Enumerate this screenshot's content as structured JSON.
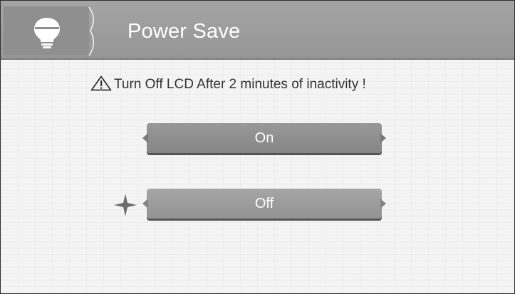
{
  "header": {
    "title": "Power Save",
    "icon": "lightbulb-icon"
  },
  "message": {
    "icon": "warning-icon",
    "text": "Turn Off LCD After 2 minutes of inactivity !"
  },
  "options": [
    {
      "label": "On",
      "selected": false
    },
    {
      "label": "Off",
      "selected": true
    }
  ],
  "selection_marker_icon": "four-point-star-icon",
  "colors": {
    "header": "#9d9d9d",
    "button": "#8f8f8f",
    "text": "#333333"
  }
}
